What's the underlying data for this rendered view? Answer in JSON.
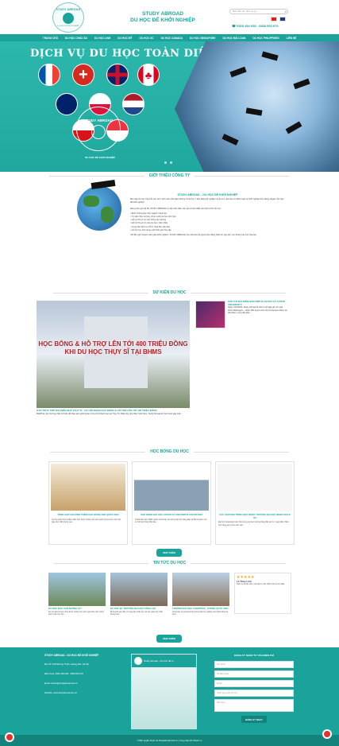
{
  "header": {
    "logo_ring": "STUDY ABROAD",
    "logo_sub": "DU HỌC ĐỂ KHỞI NGHIỆP",
    "brand_line1": "STUDY ABROAD",
    "brand_line2": "DU HỌC ĐỂ KHỞI NGHIỆP",
    "search_placeholder": "Bạn cần tìm dịch vụ gì...",
    "phones": "☎ 0905 484 698 · 0868 553 670"
  },
  "nav": [
    "TRANG CHỦ",
    "DU HỌC CHÂU ÂU",
    "DU HỌC ANH",
    "DU HỌC MỸ",
    "DU HỌC ÚC",
    "DU HỌC CANADA",
    "DU HỌC SINGAPORE",
    "DU HỌC ĐÀI LOAN",
    "DU HỌC PHILIPPINES",
    "LIÊN HỆ"
  ],
  "hero": {
    "title": "DỊCH VỤ DU HỌC TOÀN DIỆN",
    "logo_ring": "STUDY ABROAD",
    "tagline": "DU HỌC ĐỂ KHỞI NGHIỆP"
  },
  "intro": {
    "section_title": "GIỚI THIỆU CÔNG TY",
    "heading": "STUDY ABROAD – DU HỌC ĐỂ KHỞI NGHIỆP",
    "p1": "Mục tiêu du học của mỗi học sinh, sinh viên Việt Nam không chỉ là học 1 tấm bằng tốt nghiệp mà là có 1 việc làm ổn định hoặc tự khởi nghiệp theo đúng slogan \"Du học để khởi nghiệp\".",
    "p2": "Đứng trên góc độ đó, STUDY ABROAD tư vấn toàn diện các yếu tố cần thiết cho hành trình du học:",
    "bullets": [
      "Định hướng lựa chọn ngành, khoá học",
      "Tư vấn chọn trường, chọn nước du học phù hợp",
      "Hỗ trợ hồ sơ xin học bổng các trường",
      "Hỗ trợ hồ sơ xin visa du học, thăm thân",
      "Cung cấp dịch vụ chỗ ở, đưa đón sân bay",
      "Hỗ trợ học sinh trong suốt thời gian học tập"
    ],
    "p3": "Với đội ngũ chuyên viên giàu kinh nghiệm, STUDY ABROAD cam kết luôn là người bạn đồng hành tin cậy trên con đường du học của bạn."
  },
  "events": {
    "section_title": "SỰ KIỆN DU HỌC",
    "banner_line1": "HỌC BỔNG & HỖ TRỢ LÊN TỚI 400 TRIỆU ĐỒNG",
    "banner_line2": "KHI DU HỌC THỤY SĨ TẠI BHMS",
    "main_caption": "GẶP TRỰC TIẾP ĐẠI DIỆN NHÀ THỤY SĨ - CƠ HỘI NHẬN HỌC BỔNG & HỖ TRỢ LÊN TỚI 400 TRIỆU ĐỒNG",
    "main_desc": "BHMS là một trường nhiệt tình lâu đời đào tạo nghề Quản trị Du lịch Khách sạn tại Thụy Sĩ. Nhân dịp ghé thăm Việt Nam, Study Abroad tổ chức buổi gặp mặt...",
    "side_title": "GẶP GỠ ĐẠI DIỆN ONCAMPUS ASTON VÀ ASTON UNIVERSITY",
    "side_desc": "Ngày 13/4/2023, Study Abroad tổ chức buổi gặp gỡ với ngài Ross Warrington – Giám đốc tuyển sinh của Oncampus Aston tại Việt Nam, cùng đại diện..."
  },
  "scholarships": {
    "section_title": "HỌC BỔNG DU HỌC",
    "cards": [
      {
        "title": "TỔNG HỢP CHƯƠNG TRÌNH HỌC BỔNG ANH QUỐC 2023",
        "desc": "Vương quốc Anh là điểm đến luôn được nhiều sinh viên quốc tế lựa chọn nhờ nền giáo dục chất lượng cao..."
      },
      {
        "title": "HỌC BỔNG ĐẠI HỌC ASTON VÀ ONCAMPUS ASTON 2023",
        "desc": "Thành lập năm 1895, Aston University là trường đại học hàng đầu tại Birmingham với cơ hội học bổng hấp dẫn..."
      },
      {
        "title": "CÁC CHƯƠNG TRÌNH HỌC BỔNG TRƯỜNG ĐẠI HỌC NEWCASTLE ÚC",
        "desc": "Đại học Newcastle luôn nằm trong top các trường hàng đầu tại Úc, mang đến nhiều học bổng giá trị cho sinh viên..."
      }
    ],
    "more_button": "XEM THÊM"
  },
  "news": {
    "section_title": "TIN TỨC DU HỌC",
    "items": [
      {
        "title": "DU HỌC ĐỨC CẦN NHỮNG GÌ?",
        "desc": "Du học Đức là lựa chọn được nhiều học sinh quan tâm nhờ chính sách miễn học phí..."
      },
      {
        "title": "DU HỌC BỈ: TRƯỜNG ĐẠI HỌC CÔNG LẬP",
        "desc": "Bỉ là quốc gia nằm ở trung tâm châu Âu với nền giáo dục chất lượng cao..."
      },
      {
        "title": "TRƯỜNG ĐẠI HỌC LIVERPOOL, VƯƠNG QUỐC ANH",
        "desc": "University of Liverpool là trường đại học nghiên cứu danh tiếng tại Anh..."
      },
      {
        "title": "ĐÁNH GIÁ TỪ HỌC VIÊN",
        "desc": "Dịch vụ rất tận tình, các bạn tư vấn nhiệt tình và chu đáo."
      }
    ],
    "reviewer": "Lê Thùy Linh",
    "more_button": "XEM THÊM"
  },
  "footer": {
    "company": "STUDY ABROAD - DU HỌC ĐỂ KHỞI NGHIỆP",
    "address": "Địa chỉ: 61/8 Đường Thiếu, Hoàng Mai, Hà Nội",
    "hotline": "Điện thoại: 0905 484 698 - 0868 553 670",
    "email": "Email: duhoc@studyabroad.edu.vn",
    "website": "Website: www.studyabroad.edu.vn",
    "fanpage": "Study Abroad - Du học để k...",
    "form_title": "ĐĂNG KÝ NHẬN TƯ VẤN MIỄN PHÍ",
    "fields": [
      "Họ và tên",
      "Số điện thoại",
      "Email",
      "Quốc gia muốn du học",
      "Nội dung"
    ],
    "submit": "ĐĂNG KÝ NGAY",
    "copyright": "© Bản quyền thuộc về Studyabroad.edu.vn | Cung cấp bởi Nhanh.vn"
  },
  "colors": {
    "primary": "#1aa39b",
    "hero_bg": "#2cb7ad",
    "accent_red": "#c0191e"
  }
}
